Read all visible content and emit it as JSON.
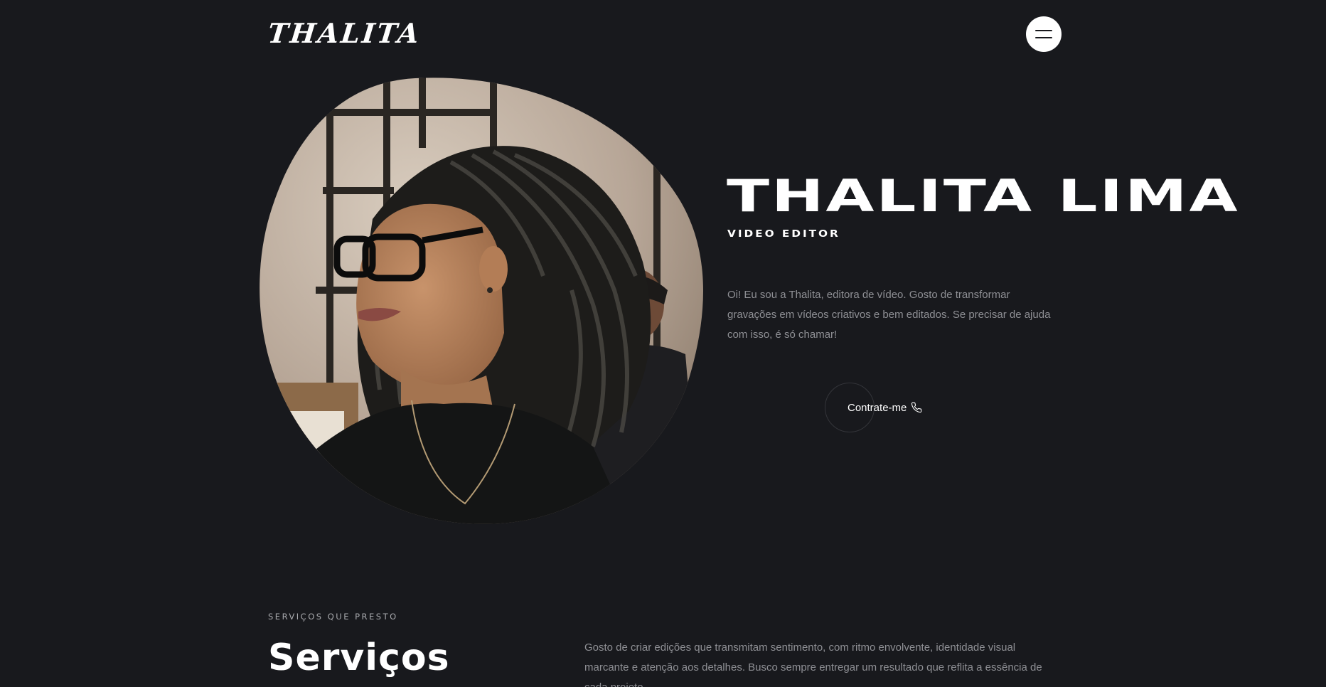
{
  "header": {
    "logo": "THALITA",
    "menu_icon": "hamburger-menu-icon"
  },
  "hero": {
    "photo_alt": "portrait-photo",
    "name": "THALITA LIMA",
    "role": "VIDEO EDITOR",
    "description": "Oi! Eu sou a Thalita, editora de vídeo. Gosto de transformar gravações em vídeos criativos e bem editados. Se precisar de ajuda com isso, é só chamar!",
    "cta_label": "Contrate-me",
    "cta_icon": "phone-icon"
  },
  "services": {
    "eyebrow": "SERVIÇOS QUE PRESTO",
    "title": "Serviços",
    "description": "Gosto de criar edições que transmitam sentimento, com ritmo envolvente, identidade visual marcante e atenção aos detalhes. Busco sempre entregar um resultado que reflita a essência de cada projeto."
  },
  "colors": {
    "background": "#18191d",
    "text_primary": "#ffffff",
    "text_muted": "#8e8f94"
  }
}
